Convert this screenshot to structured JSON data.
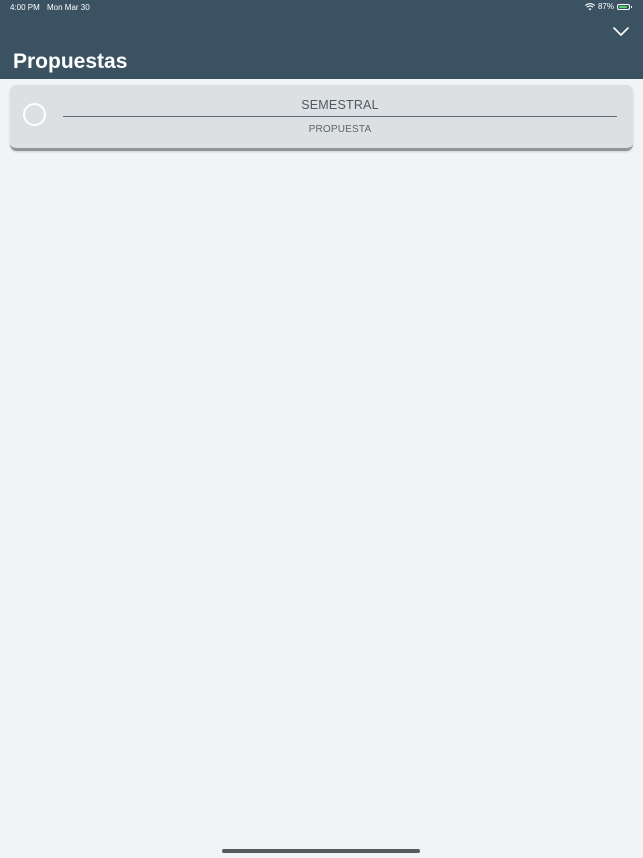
{
  "status_bar": {
    "time": "4:00 PM",
    "date": "Mon Mar 30",
    "battery_percent": "87%",
    "battery_level": 0.87
  },
  "header": {
    "title": "Propuestas",
    "menu_icon": "chevron-down-icon"
  },
  "list": {
    "items": [
      {
        "title": "SEMESTRAL",
        "subtitle": "PROPUESTA",
        "selected": false
      }
    ]
  },
  "colors": {
    "header_bg": "#3a5262",
    "page_bg": "#f1f3f4",
    "card_bg": "#dce0e2",
    "battery_green": "#4cd964"
  }
}
